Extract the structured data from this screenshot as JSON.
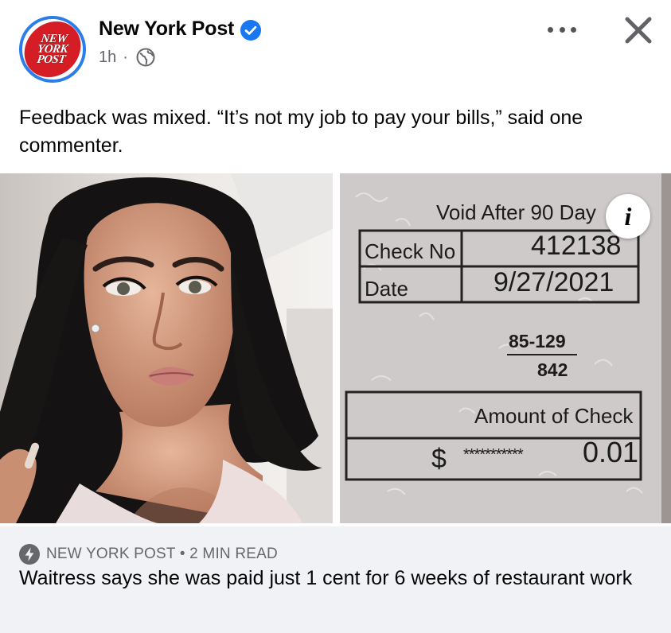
{
  "post": {
    "page_name": "New York Post",
    "time_ago": "1h",
    "separator": "·",
    "logo_text": [
      "NEW",
      "YORK",
      "POST"
    ],
    "caption": "Feedback was mixed. “It’s not my job to pay your bills,” said one commenter."
  },
  "check": {
    "void_text": "Void After 90 Day",
    "check_no_label": "Check No",
    "check_no_value": "412138",
    "date_label": "Date",
    "date_value": "9/27/2021",
    "routing_top": "85-129",
    "routing_bottom": "842",
    "amount_label": "Amount of Check",
    "dollar_sign": "$",
    "stars": "***********",
    "amount_value": "0.01"
  },
  "link": {
    "source": "NEW YORK POST • 2 MIN READ",
    "headline": "Waitress says she was paid just 1 cent for 6 weeks of restaurant work"
  },
  "icons": {
    "verified": "verified-badge-icon",
    "globe": "globe-icon",
    "more": "more-options-icon",
    "close": "close-icon",
    "info": "info-icon",
    "bolt": "instant-article-bolt-icon"
  },
  "colors": {
    "verified_blue": "#1877f2",
    "logo_red": "#d41d24",
    "secondary_text": "#65676b",
    "link_bg": "#f0f2f5"
  }
}
